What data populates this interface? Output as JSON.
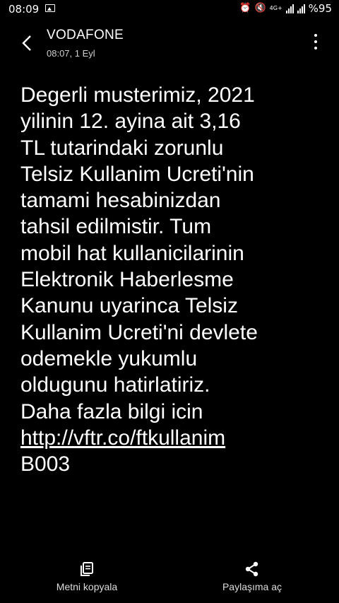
{
  "status_bar": {
    "time": "08:09",
    "network": "4G+",
    "battery": "%95"
  },
  "header": {
    "sender": "VODAFONE",
    "datetime": "08:07, 1 Eyl"
  },
  "message": {
    "lines": [
      "Degerli musterimiz, 2021",
      "yilinin 12. ayina ait 3,16",
      "TL tutarindaki zorunlu",
      "Telsiz Kullanim Ucreti'nin",
      "tamami hesabinizdan",
      "tahsil edilmistir. Tum",
      "mobil hat kullanicilarinin",
      "Elektronik Haberlesme",
      "Kanunu uyarinca Telsiz",
      "Kullanim Ucreti'ni devlete",
      "odemekle yukumlu",
      "oldugunu hatirlatiriz.",
      "Daha fazla bilgi icin"
    ],
    "link": "http://vftr.co/ftkullanim",
    "code": "B003"
  },
  "actions": {
    "copy_label": "Metni kopyala",
    "share_label": "Paylaşıma aç"
  }
}
